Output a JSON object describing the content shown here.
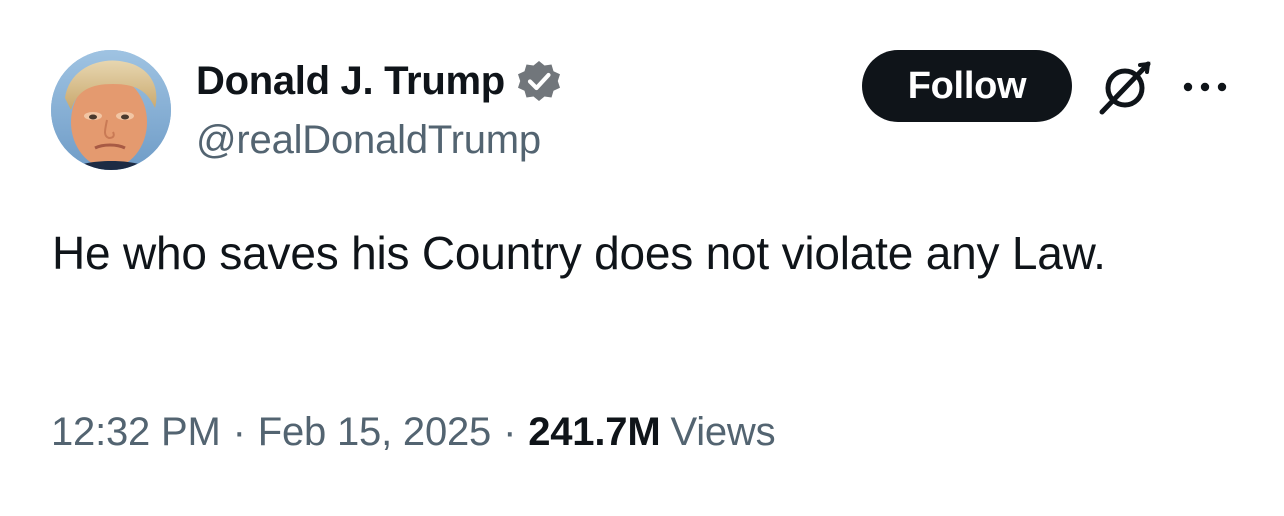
{
  "author": {
    "display_name": "Donald J. Trump",
    "handle": "@realDonaldTrump",
    "verified": true,
    "verified_badge_color": "#71767b",
    "avatar_icon": "profile-photo"
  },
  "actions": {
    "follow_label": "Follow",
    "grok_icon": "grok-icon",
    "more_icon": "more-options-icon"
  },
  "tweet": {
    "text": "He who saves his Country does not violate any Law."
  },
  "meta": {
    "time": "12:32 PM",
    "separator": "·",
    "date": "Feb 15, 2025",
    "views_count": "241.7M",
    "views_label": "Views"
  },
  "colors": {
    "text_primary": "#0f1419",
    "text_secondary": "#536471",
    "button_bg": "#0f1419",
    "button_text": "#ffffff"
  }
}
